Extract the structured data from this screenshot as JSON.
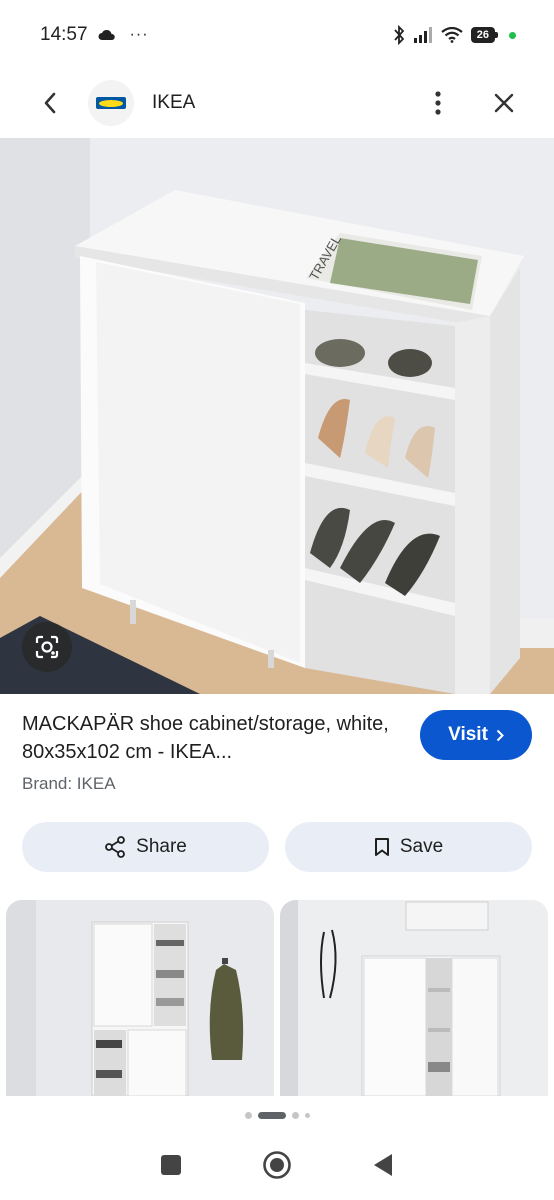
{
  "status_bar": {
    "time": "14:57",
    "more_indicator": "···",
    "battery": "26",
    "icons": [
      "cloud-icon",
      "bluetooth-icon",
      "signal-icon",
      "wifi-icon",
      "battery-icon"
    ]
  },
  "app_bar": {
    "site_name": "IKEA",
    "icons": [
      "back-arrow-icon",
      "ikea-logo",
      "more-vert-icon",
      "close-icon"
    ]
  },
  "product": {
    "title": "MACKAPÄR shoe cabinet/storage, white, 80x35x102 cm - IKEA...",
    "brand": "Brand: IKEA",
    "visit_label": "Visit",
    "magazine_text": "TRAVEL"
  },
  "actions": {
    "share_label": "Share",
    "save_label": "Save"
  },
  "pager": {
    "active_index": 1,
    "count": 4
  },
  "colors": {
    "accent": "#0b57d0",
    "pill_bg": "#e9eef6",
    "ikea_blue": "#0058a3",
    "ikea_yellow": "#ffda1a"
  }
}
